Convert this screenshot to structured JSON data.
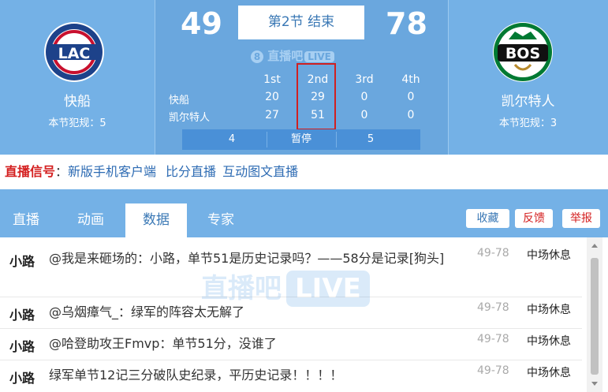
{
  "home": {
    "name": "快船",
    "abbr": "LAC",
    "fouls": "本节犯规：5",
    "score": "49"
  },
  "away": {
    "name": "凯尔特人",
    "abbr": "BOS",
    "fouls": "本节犯规：3",
    "score": "78"
  },
  "status": "第2节 结束",
  "watermark": {
    "brand": "直播吧",
    "live": "LIVE"
  },
  "quarters": [
    "1st",
    "2nd",
    "3rd",
    "4th"
  ],
  "scoreboard": [
    {
      "team": "快船",
      "scores": [
        "20",
        "29",
        "0",
        "0"
      ]
    },
    {
      "team": "凯尔特人",
      "scores": [
        "27",
        "51",
        "0",
        "0"
      ]
    }
  ],
  "timeouts": {
    "home": "4",
    "label": "暂停",
    "away": "5"
  },
  "signal": {
    "label": "直播信号",
    "colon": "：",
    "links": [
      "新版手机客户端",
      "比分直播",
      "互动图文直播"
    ]
  },
  "tabs": [
    "直播",
    "动画",
    "数据",
    "专家"
  ],
  "actions": {
    "collect": "收藏",
    "feedback": "反馈",
    "report": "举报"
  },
  "comments": [
    {
      "author": "小路",
      "text": "@我是来砸场的：小路，单节51是历史记录吗？——58分是记录[狗头]",
      "score": "49-78",
      "status": "中场休息"
    },
    {
      "author": "小路",
      "text": "@乌烟瘴气_：绿军的阵容太无解了",
      "score": "49-78",
      "status": "中场休息"
    },
    {
      "author": "小路",
      "text": "@哈登助攻王Fmvp：单节51分，没谁了",
      "score": "49-78",
      "status": "中场休息"
    },
    {
      "author": "小路",
      "text": "绿军单节12记三分破队史纪录，平历史记录！！！！",
      "score": "49-78",
      "status": "中场休息"
    }
  ],
  "colors": {
    "header": "#74b1e6",
    "center": "#6aa7de",
    "timeout_bar": "#4a90d7",
    "highlight": "#d02020",
    "signal_label": "#d41f1f",
    "link": "#2d6bb3"
  }
}
